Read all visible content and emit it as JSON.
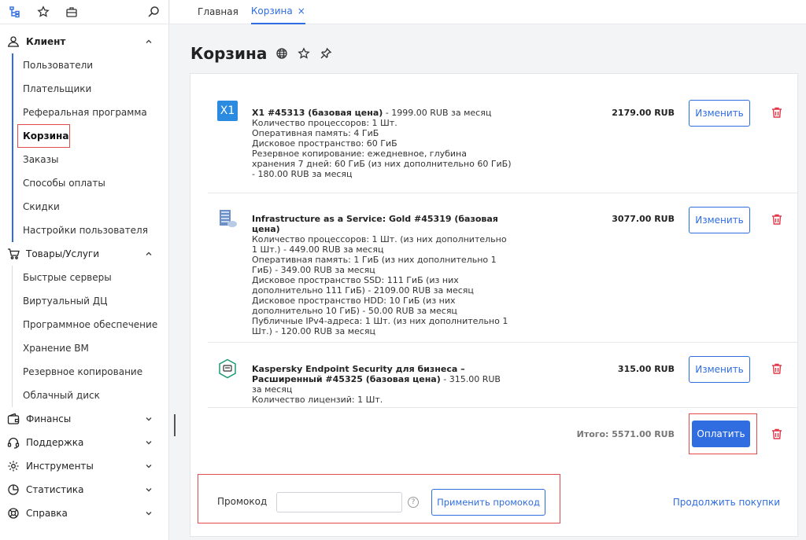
{
  "tabs": [
    {
      "label": "Главная"
    },
    {
      "label": "Корзина",
      "close": "×"
    }
  ],
  "sidebar": {
    "client": {
      "label": "Клиент",
      "items": [
        "Пользователи",
        "Плательщики",
        "Реферальная программа",
        "Корзина",
        "Заказы",
        "Способы оплаты",
        "Скидки",
        "Настройки пользователя"
      ]
    },
    "goods": {
      "label": "Товары/Услуги",
      "items": [
        "Быстрые серверы",
        "Виртуальный ДЦ",
        "Программное обеспечение",
        "Хранение ВМ",
        "Резервное копирование",
        "Облачный диск"
      ]
    },
    "sections": [
      "Финансы",
      "Поддержка",
      "Инструменты",
      "Статистика",
      "Справка"
    ]
  },
  "page": {
    "title": "Корзина"
  },
  "cart": {
    "items": [
      {
        "icon_text": "X1",
        "name": "X1 #45313 (базовая цена)",
        "base_price": " - 1999.00 RUB за месяц",
        "details": [
          "Количество процессоров: 1 Шт.",
          "Оперативная память: 4 ГиБ",
          "Дисковое пространство: 60 ГиБ",
          "Резервное копирование: ежедневное, глубина хранения 7 дней: 60 ГиБ (из них дополнительно 60 ГиБ) - 180.00 RUB за месяц"
        ],
        "price": "2179.00 RUB",
        "edit_label": "Изменить"
      },
      {
        "name": "Infrastructure as a Service: Gold #45319 (базовая цена)",
        "base_price": "",
        "details": [
          "Количество процессоров: 1 Шт. (из них дополнительно 1 Шт.) - 449.00 RUB за месяц",
          "Оперативная память: 1 ГиБ (из них дополнительно 1 ГиБ) - 349.00 RUB за месяц",
          "Дисковое пространство SSD: 111 ГиБ (из них дополнительно 111 ГиБ) - 2109.00 RUB за месяц",
          "Дисковое пространство HDD: 10 ГиБ (из них дополнительно 10 ГиБ) - 50.00 RUB за месяц",
          "Публичные IPv4-адреса: 1 Шт. (из них дополнительно 1 Шт.) - 120.00 RUB за месяц"
        ],
        "price": "3077.00 RUB",
        "edit_label": "Изменить"
      },
      {
        "name": "Kaspersky Endpoint Security для бизнеса – Расширенный #45325 (базовая цена)",
        "base_price": " - 315.00 RUB за месяц",
        "details": [
          "Количество лицензий: 1 Шт."
        ],
        "price": "315.00 RUB",
        "edit_label": "Изменить"
      }
    ],
    "total": "Итого: 5571.00 RUB",
    "pay_label": "Оплатить",
    "promo_label": "Промокод",
    "promo_value": "",
    "help_symbol": "?",
    "apply_promo_label": "Применить промокод",
    "continue_label": "Продолжить покупки"
  },
  "colors": {
    "accent": "#2f6de0",
    "highlight": "#e24b4b",
    "trash": "#e0394a"
  }
}
